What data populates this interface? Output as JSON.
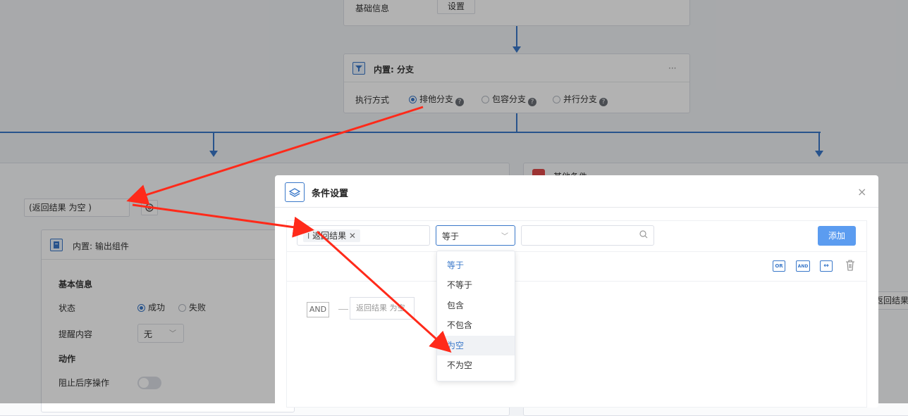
{
  "flow": {
    "top_card": {
      "label": "基础信息",
      "button": "设置"
    },
    "branch_node": {
      "title": "内置: 分支",
      "more": "···",
      "exec_label": "执行方式",
      "options": [
        {
          "label": "排他分支",
          "checked": true
        },
        {
          "label": "包容分支",
          "checked": false
        },
        {
          "label": "并行分支",
          "checked": false
        }
      ],
      "help": "?"
    },
    "right_card_title": "其他条件",
    "condition_tag": "(返回结果 为空 )",
    "right_edge_text": "返回结果",
    "output_node": {
      "title": "内置: 输出组件",
      "section_basic": "基本信息",
      "status_label": "状态",
      "status_success": "成功",
      "status_fail": "失败",
      "remind_label": "提醒内容",
      "remind_value": "无",
      "section_action": "动作",
      "block_label": "阻止后序操作"
    }
  },
  "modal": {
    "title": "条件设置",
    "field_tag": "返回结果",
    "operator_value": "等于",
    "add_button": "添加",
    "toolbar": {
      "or": "OR",
      "and": "AND"
    },
    "expr_and": "AND",
    "expr_item": "返回结果 为空",
    "operator_options": [
      "等于",
      "不等于",
      "包含",
      "不包含",
      "为空",
      "不为空"
    ]
  },
  "colors": {
    "accent": "#3a78c9",
    "annotation": "#ff2a1a",
    "add_button": "#5b9cf0"
  }
}
